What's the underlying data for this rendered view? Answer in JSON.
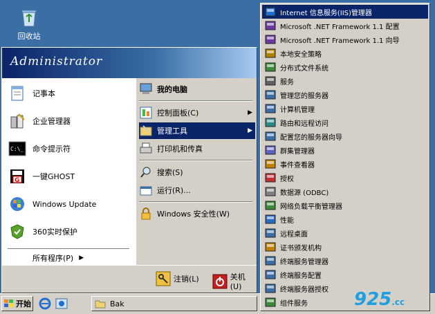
{
  "desktop": {
    "recycle_bin_label": "回收站"
  },
  "start_menu": {
    "user": "Administrator",
    "left_items": [
      {
        "label": "记事本",
        "icon": "notepad-icon"
      },
      {
        "label": "企业管理器",
        "icon": "enterprise-manager-icon"
      },
      {
        "label": "命令提示符",
        "icon": "cmd-icon"
      },
      {
        "label": "一键GHOST",
        "icon": "ghost-icon"
      },
      {
        "label": "Windows Update",
        "icon": "windows-update-icon"
      },
      {
        "label": "360实时保护",
        "icon": "shield-360-icon"
      }
    ],
    "all_programs": "所有程序(P)",
    "right_items": [
      {
        "label": "我的电脑",
        "icon": "my-computer-icon"
      },
      {
        "label": "控制面板(C)",
        "icon": "control-panel-icon"
      },
      {
        "label": "管理工具",
        "icon": "admin-tools-icon"
      },
      {
        "label": "打印机和传真",
        "icon": "printer-icon"
      },
      {
        "label": "搜索(S)",
        "icon": "search-icon"
      },
      {
        "label": "运行(R)...",
        "icon": "run-icon"
      },
      {
        "label": "Windows 安全性(W)",
        "icon": "lock-icon"
      }
    ],
    "logoff": "注销(L)",
    "shutdown": "关机(U)"
  },
  "taskbar": {
    "start_label": "开始",
    "window_button": "Bak"
  },
  "submenu": {
    "items": [
      "Internet 信息服务(IIS)管理器",
      "Microsoft .NET Framework 1.1 配置",
      "Microsoft .NET Framework 1.1 向导",
      "本地安全策略",
      "分布式文件系统",
      "服务",
      "管理您的服务器",
      "计算机管理",
      "路由和远程访问",
      "配置您的服务器向导",
      "群集管理器",
      "事件查看器",
      "授权",
      "数据源 (ODBC)",
      "网络负载平衡管理器",
      "性能",
      "远程桌面",
      "证书颁发机构",
      "终端服务管理器",
      "终端服务配置",
      "终端服务器授权",
      "组件服务"
    ]
  },
  "watermark": {
    "main": "925",
    "suffix": ".cc"
  }
}
